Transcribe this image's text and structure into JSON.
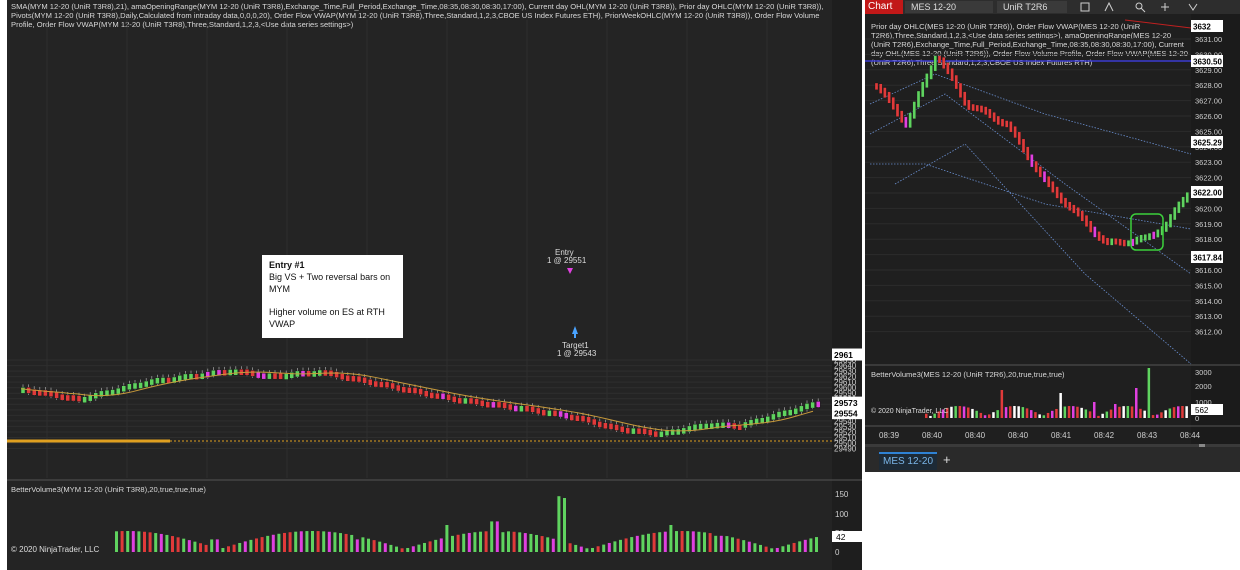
{
  "left_chart": {
    "indicator_text": "SMA(MYM 12-20 (UniR T3R8),21), amaOpeningRange(MYM 12-20 (UniR T3R8),Exchange_Time,Full_Period,Exchange_Time,08:35,08:30,08:30,17:00), Current day OHL(MYM 12-20 (UniR T3R8)), Prior day OHLC(MYM 12-20 (UniR T3R8)), Pivots(MYM 12-20 (UniR T3R8),Daily,Calculated from intraday data,0,0,0,20), Order Flow VWAP(MYM 12-20 (UniR T3R8),Three,Standard,1,2,3,CBOE US Index Futures ETH), PriorWeekOHLC(MYM 12-20 (UniR T3R8)), Order Flow Volume Profile, Order Flow VWAP(MYM 12-20 (UniR T3R8),Three,Standard,1,2,3,<Use data series settings>)",
    "axis_ticks": [
      "29650",
      "29640",
      "29630",
      "29620",
      "29610",
      "29600",
      "29590",
      "29580",
      "29570",
      "29560",
      "29550",
      "29540",
      "29530",
      "29520",
      "29510",
      "29500",
      "29490"
    ],
    "price_tags": [
      {
        "label": "29573",
        "value": 29573,
        "bg": "#ffffff",
        "fg": "#000000"
      },
      {
        "label": "29554",
        "value": 29554,
        "bg": "#ffffff",
        "fg": "#000000"
      },
      {
        "label": "2961",
        "value": 29660,
        "bg": "#ffffff",
        "fg": "#000000"
      }
    ],
    "entry_label": "Entry",
    "entry_price": "1 @ 29551",
    "target_label": "Target1",
    "target_price": "1 @ 29543",
    "annotation": {
      "title": "Entry #1",
      "line1": "Big VS + Two reversal bars on MYM",
      "line2": "Higher volume on ES at RTH VWAP"
    },
    "volume_panel": {
      "title": "BetterVolume3(MYM 12-20 (UniR T3R8),20,true,true,true)",
      "axis_ticks": [
        "150",
        "100",
        "50",
        "0"
      ],
      "tag": "42",
      "copyright": "© 2020 NinjaTrader, LLC"
    }
  },
  "right_chart": {
    "tab_label": "Chart",
    "instrument": "MES 12-20",
    "series": "UniR T2R6",
    "indicator_text": "Prior day OHLC(MES 12-20 (UniR T2R6)), Order Flow VWAP(MES 12-20 (UniR T2R6),Three,Standard,1,2,3,<Use data series settings>), amaOpeningRange(MES 12-20 (UniR T2R6),Exchange_Time,Full_Period,Exchange_Time,08:35,08:30,08:30,17:00), Current day OHL(MES 12-20 (UniR T2R6)), Order Flow Volume Profile, Order Flow VWAP(MES 12-20 (UniR T2R6),Three,Standard,1,2,3,CBOE US Index Futures RTH)",
    "axis_ticks": [
      "3631.00",
      "3630.00",
      "3629.00",
      "3628.00",
      "3627.00",
      "3626.00",
      "3625.00",
      "3624.00",
      "3623.00",
      "3622.00",
      "3621.00",
      "3620.00",
      "3619.00",
      "3618.00",
      "3617.00",
      "3616.00",
      "3615.00",
      "3614.00",
      "3613.00",
      "3612.00"
    ],
    "price_tags": [
      {
        "label": "3632",
        "bg": "#ffffff",
        "fg": "#000000"
      },
      {
        "label": "3630.50",
        "bg": "#ffffff",
        "fg": "#000000"
      },
      {
        "label": "3625.29",
        "bg": "#ffffff",
        "fg": "#000000"
      },
      {
        "label": "3622.00",
        "bg": "#ffffff",
        "fg": "#000000"
      },
      {
        "label": "3617.84",
        "bg": "#ffffff",
        "fg": "#000000"
      }
    ],
    "time_labels": [
      "08:39",
      "08:40",
      "08:40",
      "08:40",
      "08:41",
      "08:42",
      "08:43",
      "08:44"
    ],
    "volume_panel": {
      "title": "BetterVolume3(MES 12-20 (UniR T2R6),20,true,true,true)",
      "axis_ticks": [
        "3000",
        "2000",
        "1000",
        "0"
      ],
      "tag": "562",
      "copyright": "© 2020 NinjaTrader, LLC"
    },
    "bottom_tab": "MES 12-20",
    "add_tab": "+"
  },
  "colors": {
    "background": "#242424",
    "up": "#5fd35f",
    "down": "#e03a3a",
    "reversal": "#e040e0",
    "sma": "#c89a3a",
    "opening_range": "#e0a020",
    "vwap_band": "#6a8fd0"
  }
}
